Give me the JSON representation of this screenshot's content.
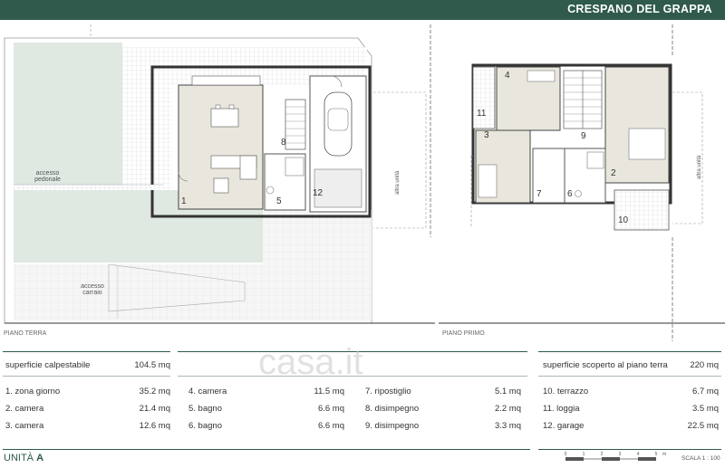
{
  "header": {
    "title": "CRESPANO DEL GRAPPA"
  },
  "ground_floor": {
    "label": "PIANO TERRA",
    "pedestrian_access": "accesso pedonale",
    "vehicle_access": "accesso carraio",
    "room_numbers": [
      "1",
      "5",
      "8",
      "12"
    ]
  },
  "first_floor": {
    "label": "PIANO PRIMO",
    "room_numbers": [
      "2",
      "3",
      "4",
      "6",
      "7",
      "9",
      "10",
      "11"
    ]
  },
  "neighbor_unit_label": "altra unità",
  "summary": {
    "walkable_label": "superficie calpestabile",
    "walkable_value": "104.5 mq",
    "uncovered_label": "superficie scoperto al piano terra",
    "uncovered_value": "220 mq"
  },
  "rooms": [
    {
      "name": "1. zona giorno",
      "area": "35.2 mq"
    },
    {
      "name": "2. camera",
      "area": "21.4 mq"
    },
    {
      "name": "3. camera",
      "area": "12.6 mq"
    },
    {
      "name": "4. camera",
      "area": "11.5 mq"
    },
    {
      "name": "5. bagno",
      "area": "6.6 mq"
    },
    {
      "name": "6. bagno",
      "area": "6.6 mq"
    },
    {
      "name": "7. ripostiglio",
      "area": "5.1 mq"
    },
    {
      "name": "8. disimpegno",
      "area": "2.2 mq"
    },
    {
      "name": "9. disimpegno",
      "area": "3.3 mq"
    },
    {
      "name": "10. terrazzo",
      "area": "6.7 mq"
    },
    {
      "name": "11. loggia",
      "area": "3.5 mq"
    },
    {
      "name": "12. garage",
      "area": "22.5 mq"
    }
  ],
  "footer": {
    "unit_label": "UNITÀ",
    "unit_letter": "A",
    "scale_label": "SCALA 1 : 100",
    "scale_ticks": [
      "0",
      "1",
      "2",
      "3",
      "4",
      "5"
    ],
    "scale_unit": "m"
  },
  "watermark": "casa.it",
  "colors": {
    "brand": "#2f5a4c",
    "living": "#e9e7dd",
    "garden": "#dfe8e1"
  }
}
